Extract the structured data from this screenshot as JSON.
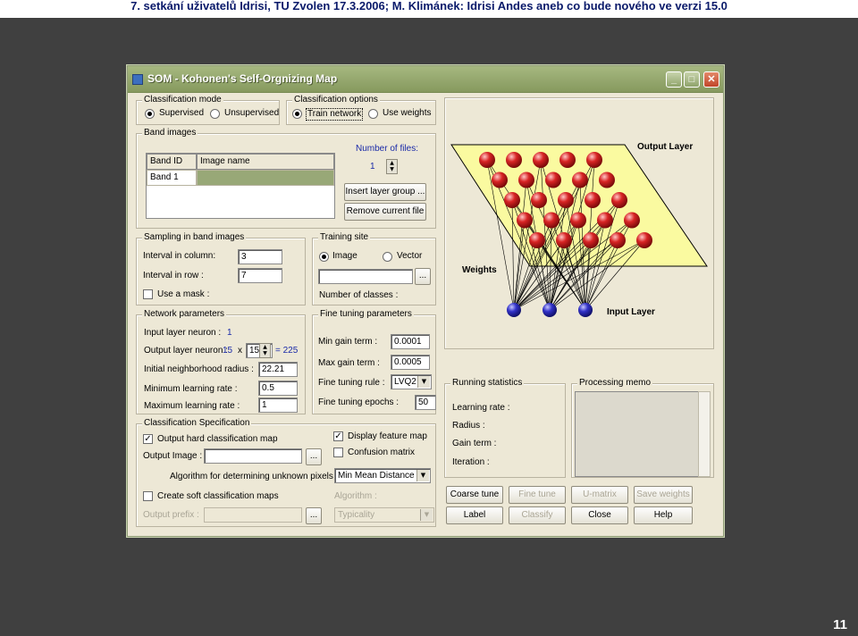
{
  "slide": {
    "title": "7. setkání uživatelů Idrisi, TU Zvolen 17.3.2006; M. Klimánek: Idrisi Andes aneb co bude nového ve verzi 15.0",
    "page_number": "11"
  },
  "window": {
    "title": "SOM - Kohonen's Self-Orgnizing Map",
    "controls": {
      "minimize": "_",
      "maximize": "□",
      "close": "✕"
    }
  },
  "classification_mode": {
    "label": "Classification mode",
    "supervised": "Supervised",
    "unsupervised": "Unsupervised",
    "selected": "supervised"
  },
  "classification_options": {
    "label": "Classification options",
    "train_network": "Train network",
    "use_weights": "Use weights",
    "selected": "train_network"
  },
  "band_images": {
    "label": "Band images",
    "col_band_id": "Band ID",
    "col_image_name": "Image name",
    "rows": [
      {
        "band_id": "Band 1",
        "image_name": ""
      }
    ],
    "num_files_label": "Number of files:",
    "num_files_value": "1",
    "insert_button": "Insert layer group ...",
    "remove_button": "Remove current file"
  },
  "sampling": {
    "label": "Sampling in band images",
    "interval_column_label": "Interval in column:",
    "interval_column_value": "3",
    "interval_row_label": "Interval in row :",
    "interval_row_value": "7",
    "use_mask_label": "Use a mask :",
    "use_mask_checked": false
  },
  "training_site": {
    "label": "Training site",
    "image": "Image",
    "vector": "Vector",
    "selected": "image",
    "browse": "...",
    "num_classes_label": "Number of classes :"
  },
  "network_params": {
    "label": "Network parameters",
    "input_neuron_label": "Input layer neuron :",
    "input_neuron_value": "1",
    "output_neuron_label": "Output layer neuron :",
    "output_rows": "15",
    "times": "x",
    "output_cols": "15",
    "output_total": "= 225",
    "neighborhood_label": "Initial neighborhood radius :",
    "neighborhood_value": "22.21",
    "min_lr_label": "Minimum learning rate :",
    "min_lr_value": "0.5",
    "max_lr_label": "Maximum learning rate :",
    "max_lr_value": "1"
  },
  "fine_tuning": {
    "label": "Fine tuning parameters",
    "min_gain_label": "Min gain term :",
    "min_gain_value": "0.0001",
    "max_gain_label": "Max gain term :",
    "max_gain_value": "0.0005",
    "rule_label": "Fine tuning rule :",
    "rule_value": "LVQ2",
    "epochs_label": "Fine tuning epochs :",
    "epochs_value": "50"
  },
  "classification_spec": {
    "label": "Classification Specification",
    "output_hard_label": "Output hard classification map",
    "output_hard_checked": true,
    "display_feature_label": "Display feature map",
    "display_feature_checked": true,
    "confusion_label": "Confusion matrix",
    "confusion_checked": false,
    "output_image_label": "Output Image :",
    "browse": "...",
    "algorithm_label": "Algorithm for determining unknown pixels :",
    "algorithm_value": "Min Mean Distance",
    "soft_label": "Create soft classification maps",
    "soft_checked": false,
    "algorithm2_label": "Algorithm :",
    "output_prefix_label": "Output prefix :",
    "typicality_value": "Typicality"
  },
  "diagram": {
    "output_layer_label": "Output Layer",
    "weights_label": "Weights",
    "input_layer_label": "Input Layer",
    "output_neuron_color": "#cc1f1f",
    "input_neuron_color": "#2a2ab0",
    "plane_color": "#fafaa0"
  },
  "running_stats": {
    "label": "Running statistics",
    "learning_rate": "Learning rate :",
    "radius": "Radius :",
    "gain_term": "Gain term :",
    "iteration": "Iteration :"
  },
  "memo": {
    "label": "Processing memo"
  },
  "buttons": {
    "coarse_tune": "Coarse tune",
    "fine_tune": "Fine tune",
    "u_matrix": "U-matrix",
    "save_weights": "Save weights",
    "label": "Label",
    "classify": "Classify",
    "close": "Close",
    "help": "Help"
  }
}
